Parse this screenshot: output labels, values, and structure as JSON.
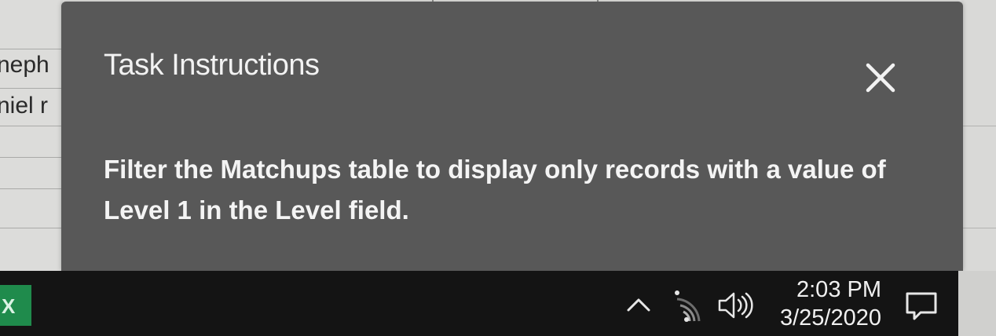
{
  "spreadsheet": {
    "cells": [
      {
        "text": "neph"
      },
      {
        "text": "niel r"
      }
    ]
  },
  "dialog": {
    "title": "Task Instructions",
    "body": "Filter the Matchups table to display only records with a value of Level 1 in the Level field.",
    "close_icon": "close-icon"
  },
  "taskbar": {
    "app_icon": "excel-icon",
    "app_glyph": "X",
    "tray": {
      "chevron_icon": "chevron-up-icon",
      "wifi_icon": "wifi-icon",
      "volume_icon": "volume-icon",
      "notifications_icon": "notifications-icon"
    },
    "clock": {
      "time": "2:03 PM",
      "date": "3/25/2020"
    }
  },
  "colors": {
    "dialog_bg": "#585858",
    "dialog_text": "#f4f4f4",
    "taskbar_bg": "#141414",
    "excel_green": "#1f8b4c"
  }
}
